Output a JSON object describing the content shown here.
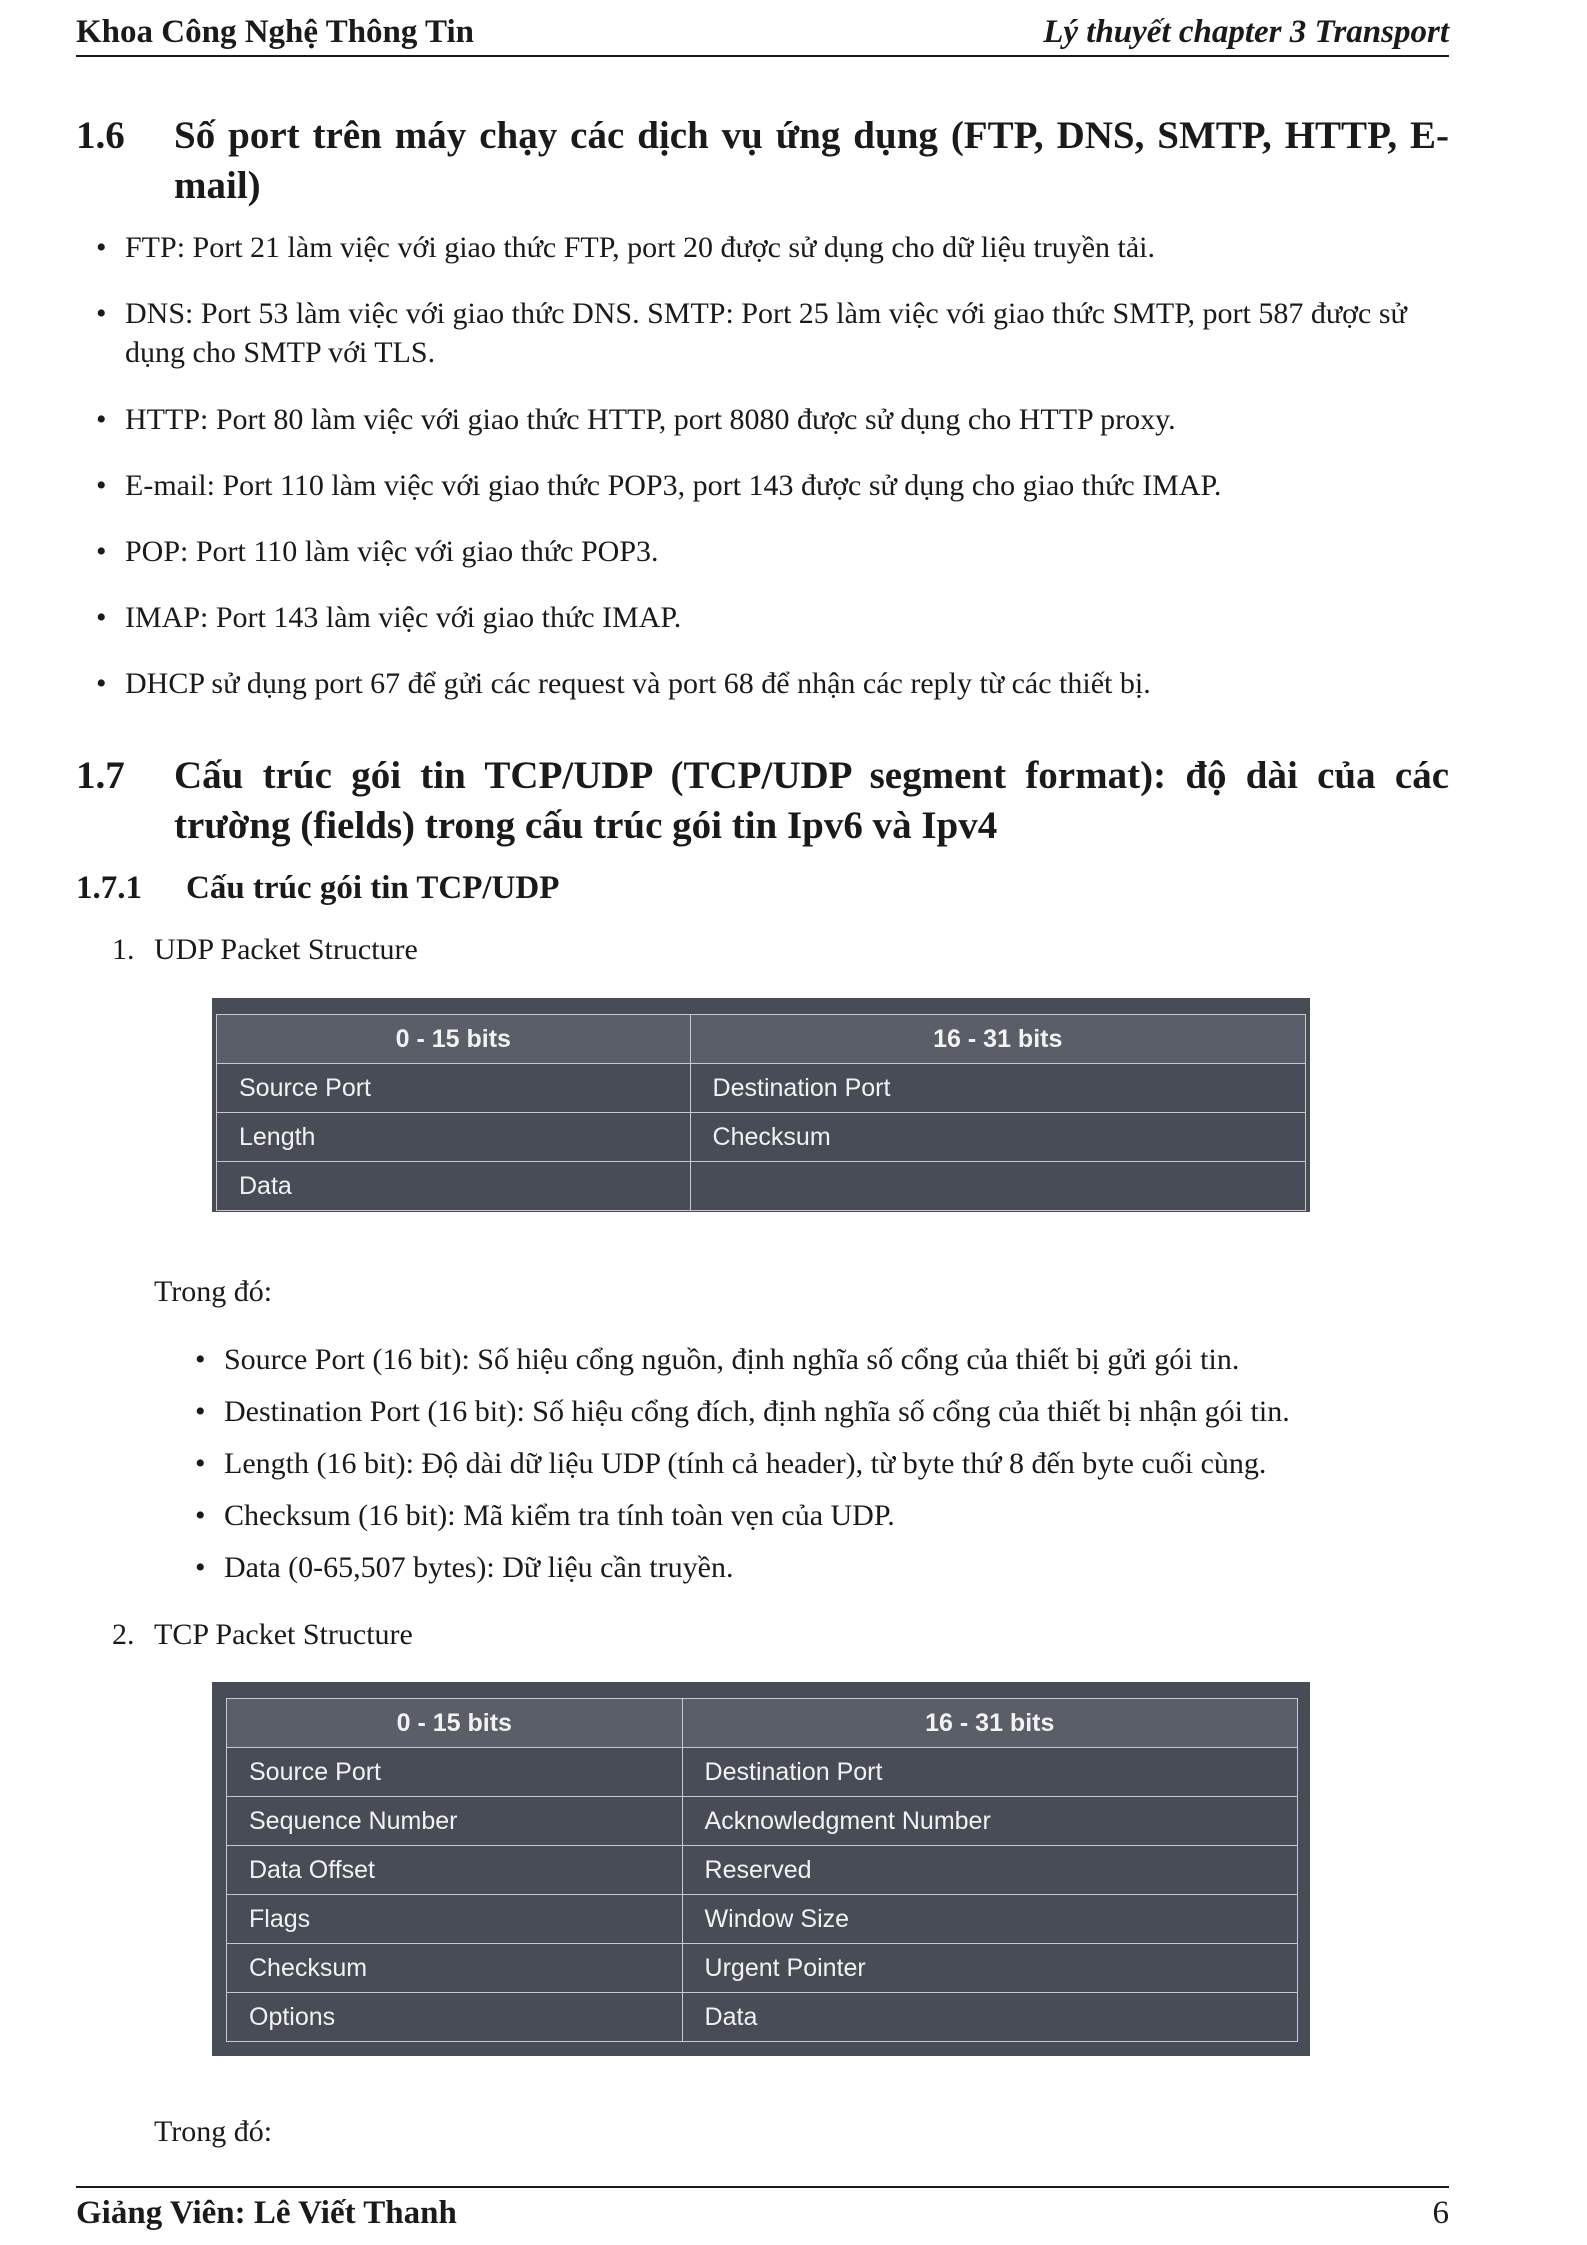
{
  "header": {
    "left": "Khoa Công Nghệ Thông Tin",
    "right": "Lý thuyết chapter 3 Transport"
  },
  "section_1_6": {
    "number": "1.6",
    "title": "Số port trên máy chạy các dịch vụ ứng dụng (FTP, DNS, SMTP, HTTP, E-mail)",
    "bullets": [
      "FTP: Port 21 làm việc với giao thức FTP, port 20 được sử dụng cho dữ liệu truyền tải.",
      "DNS: Port 53 làm việc với giao thức DNS. SMTP: Port 25 làm việc với giao thức SMTP, port 587 được sử dụng cho SMTP với TLS.",
      "HTTP: Port 80 làm việc với giao thức HTTP, port 8080 được sử dụng cho HTTP proxy.",
      "E-mail: Port 110 làm việc với giao thức POP3, port 143 được sử dụng cho giao thức IMAP.",
      "POP: Port 110 làm việc với giao thức POP3.",
      "IMAP: Port 143 làm việc với giao thức IMAP.",
      "DHCP sử dụng port 67 để gửi các request và port 68 để nhận các reply từ các thiết bị."
    ]
  },
  "section_1_7": {
    "number": "1.7",
    "title": "Cấu trúc gói tin TCP/UDP (TCP/UDP segment format): độ dài của các trường (fields) trong cấu trúc gói tin Ipv6 và Ipv4"
  },
  "subsection_1_7_1": {
    "number": "1.7.1",
    "title": "Cấu trúc gói tin TCP/UDP"
  },
  "udp": {
    "item_number": "1.",
    "heading": "UDP Packet Structure",
    "table": {
      "headers": [
        "0 - 15 bits",
        "16 - 31 bits"
      ],
      "rows": [
        [
          "Source Port",
          "Destination Port"
        ],
        [
          "Length",
          "Checksum"
        ],
        [
          "Data",
          ""
        ]
      ]
    },
    "intro": "Trong đó:",
    "bullets": [
      "Source Port (16 bit): Số hiệu cổng nguồn, định nghĩa số cổng của thiết bị gửi gói tin.",
      "Destination Port (16 bit): Số hiệu cổng đích, định nghĩa số cổng của thiết bị nhận gói tin.",
      "Length (16 bit): Độ dài dữ liệu UDP (tính cả header), từ byte thứ 8 đến byte cuối cùng.",
      "Checksum (16 bit): Mã kiểm tra tính toàn vẹn của UDP.",
      "Data (0-65,507 bytes): Dữ liệu cần truyền."
    ]
  },
  "tcp": {
    "item_number": "2.",
    "heading": "TCP Packet Structure",
    "table": {
      "headers": [
        "0 - 15 bits",
        "16 - 31 bits"
      ],
      "rows": [
        [
          "Source Port",
          "Destination Port"
        ],
        [
          "Sequence Number",
          "Acknowledgment Number"
        ],
        [
          "Data Offset",
          "Reserved"
        ],
        [
          "Flags",
          "Window Size"
        ],
        [
          "Checksum",
          "Urgent Pointer"
        ],
        [
          "Options",
          "Data"
        ]
      ]
    },
    "intro": "Trong đó:"
  },
  "footer": {
    "left": "Giảng Viên: Lê Viết Thanh",
    "page": "6"
  }
}
